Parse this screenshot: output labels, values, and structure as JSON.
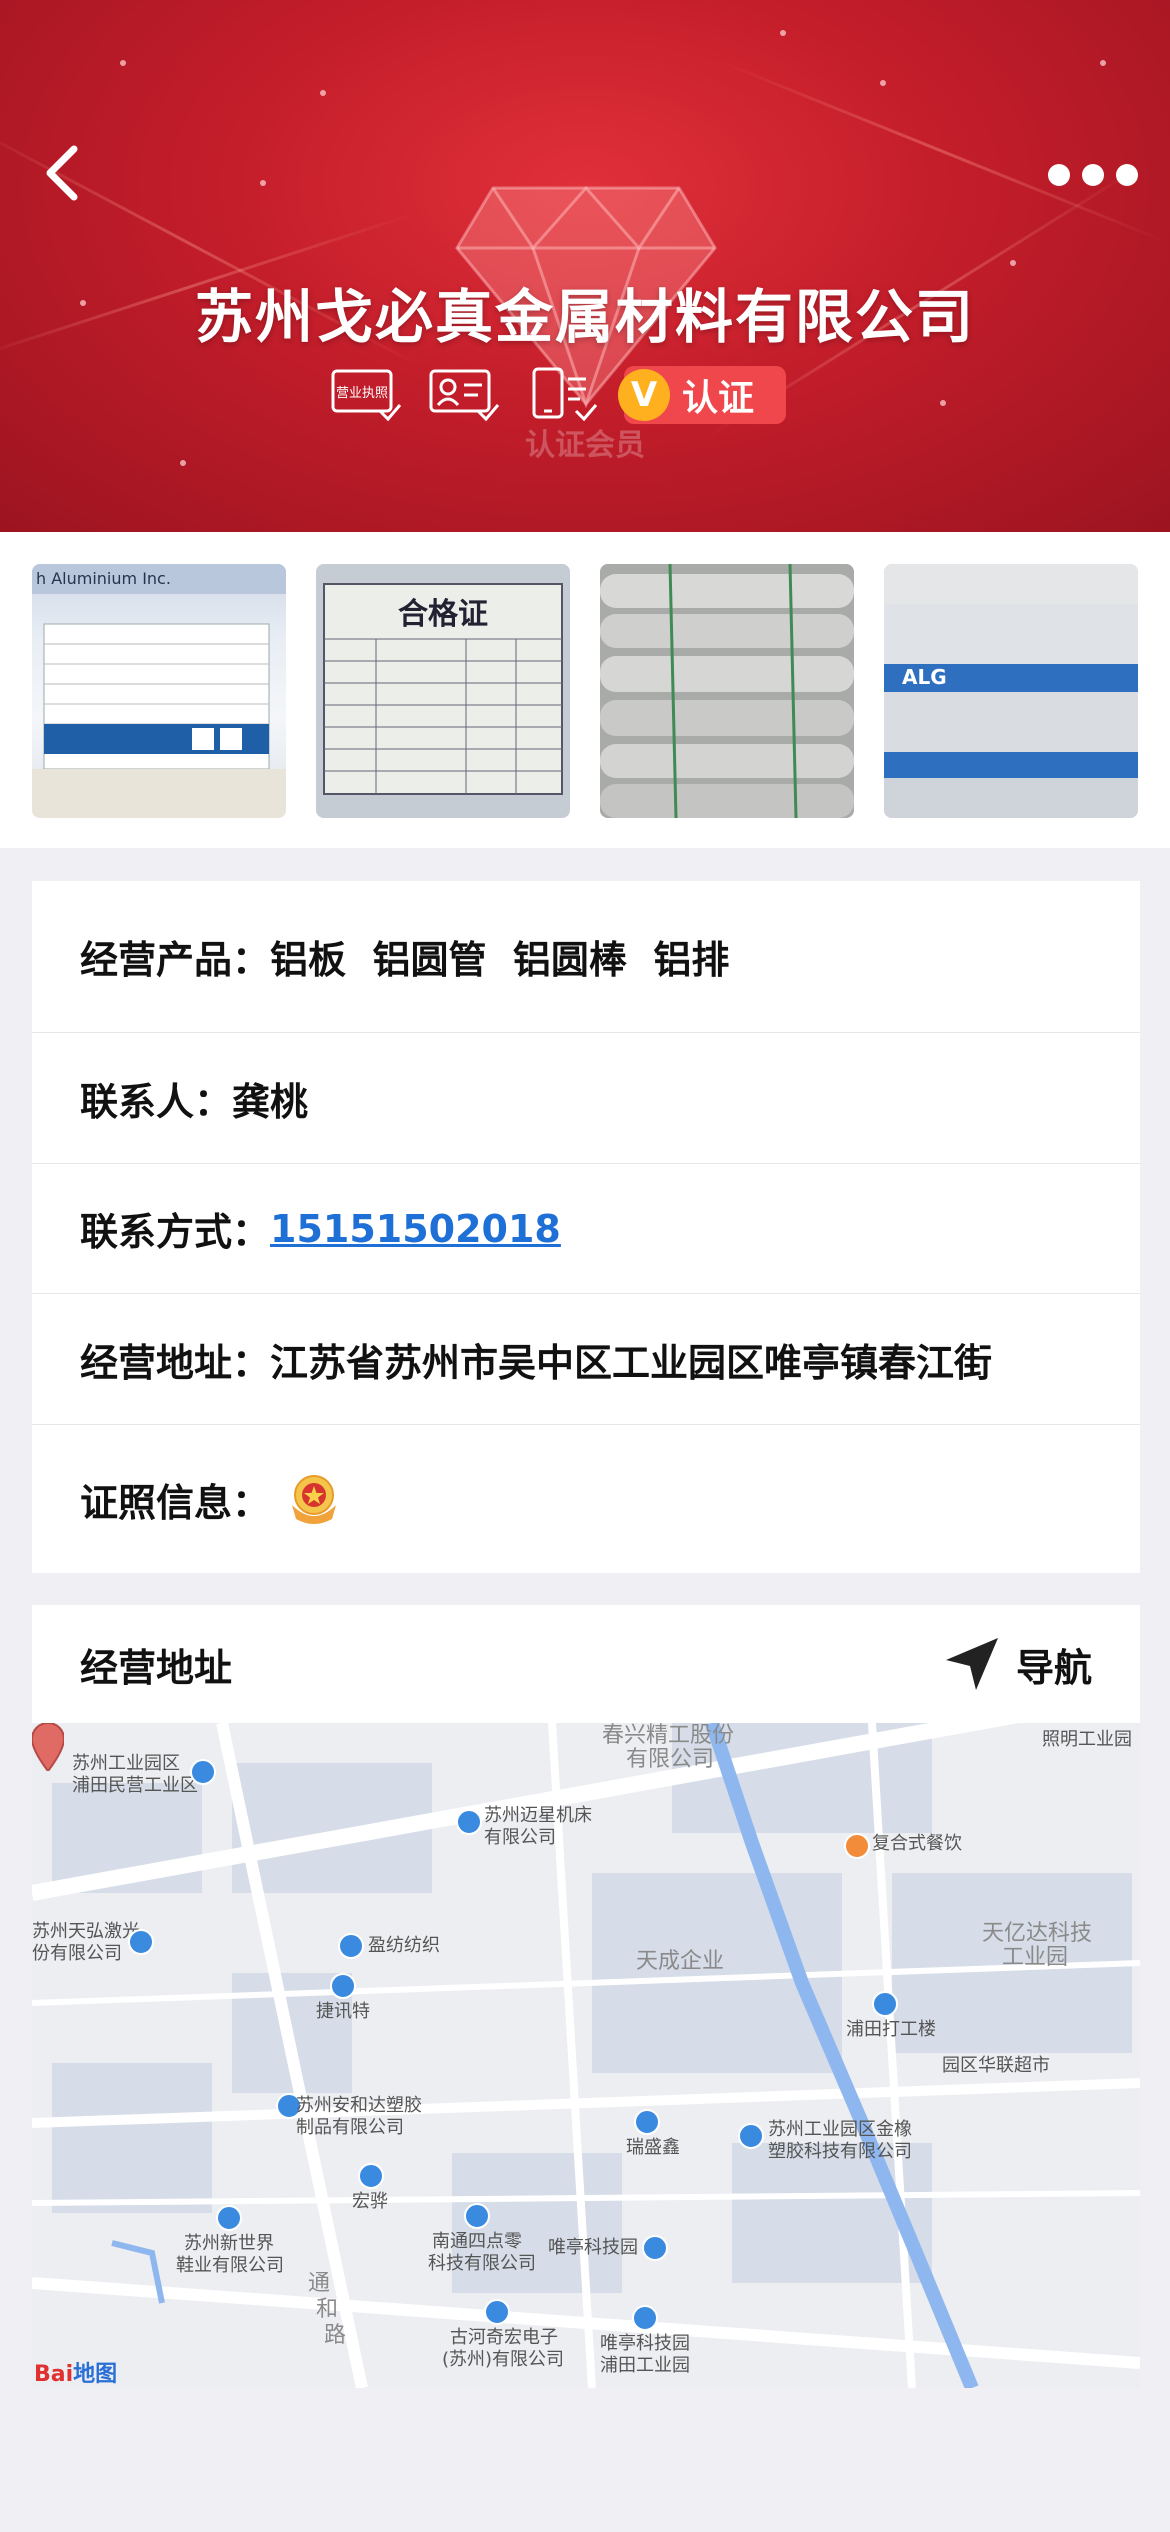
{
  "header": {
    "company_name": "苏州戈必真金属材料有限公司",
    "badges": [
      {
        "icon": "business-license-icon",
        "label": "营业执照"
      },
      {
        "icon": "id-card-icon",
        "label": ""
      },
      {
        "icon": "phone-verified-icon",
        "label": ""
      }
    ],
    "verify_badge": {
      "v": "V",
      "label": "认证"
    },
    "member_label": "认证会员",
    "colors": {
      "header_red": "#c31d2a",
      "verify_red": "#f0474d",
      "verify_gold": "#ffb01f"
    }
  },
  "gallery": {
    "images": [
      {
        "name": "product-label-photo",
        "text": "h Aluminium Inc."
      },
      {
        "name": "certificate-photo",
        "text": "合格证"
      },
      {
        "name": "aluminum-tubes-photo",
        "text": ""
      },
      {
        "name": "alg-packaging-photo",
        "text": "ALG"
      }
    ]
  },
  "info": {
    "products": {
      "label": "经营产品：",
      "value": "铝板  铝圆管  铝圆棒  铝排"
    },
    "contact": {
      "label": "联系人：",
      "value": "龚桃"
    },
    "phone": {
      "label": "联系方式：",
      "value": "15151502018"
    },
    "address": {
      "label": "经营地址：",
      "value": "江苏省苏州市吴中区工业园区唯亭镇春江街"
    },
    "license": {
      "label": "证照信息："
    }
  },
  "address_section": {
    "title": "经营地址",
    "nav_label": "导航"
  },
  "map": {
    "labels": [
      "苏州工业园区",
      "浦田民营工业区",
      "春兴精工股份",
      "有限公司",
      "苏州迈星机床",
      "有限公司",
      "复合式餐饮",
      "苏州天弘激光",
      "份有限公司",
      "盈纺纺织",
      "捷讯特",
      "天成企业",
      "天亿达科技",
      "工业园",
      "浦田打工楼",
      "园区华联超市",
      "苏州安和达塑胶",
      "制品有限公司",
      "瑞盛鑫",
      "苏州工业园区金橡",
      "塑胶科技有限公司",
      "宏骅",
      "苏州新世界",
      "鞋业有限公司",
      "南通四点零",
      "科技有限公司",
      "唯亭科技园",
      "通",
      "和",
      "路",
      "古河奇宏电子",
      "(苏州)有限公司",
      "唯亭科技园",
      "浦田工业园",
      "照明工业园"
    ],
    "logo": {
      "part1": "Bai",
      "part2": "地图"
    }
  }
}
